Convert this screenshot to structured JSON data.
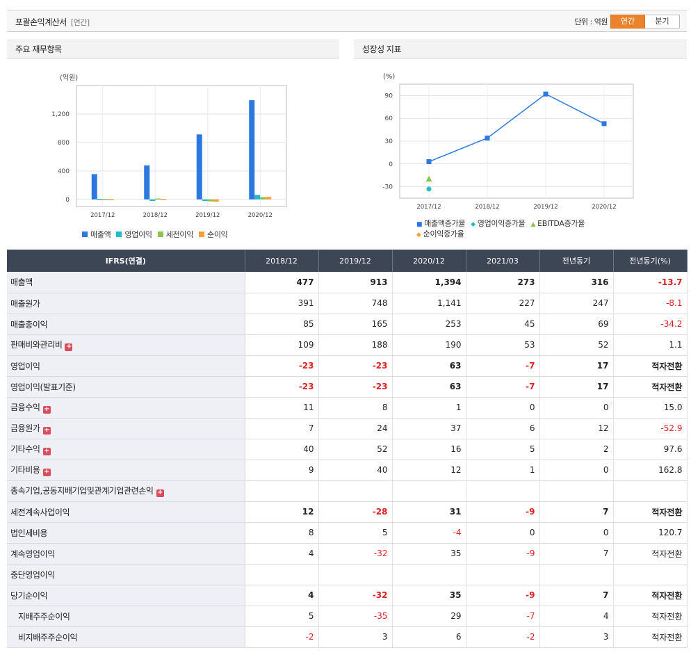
{
  "header": {
    "title": "포괄손익계산서",
    "period_tag": "[연간]",
    "unit_label": "단위 : 억원",
    "toggle": [
      "연간",
      "분기"
    ],
    "toggle_active": 0,
    "accent_color": "#e9842c"
  },
  "panel_left": {
    "title": "주요 재무항목"
  },
  "panel_right": {
    "title": "성장성 지표"
  },
  "chart_data": [
    {
      "type": "bar",
      "unit_label": "(억원)",
      "categories": [
        "2017/12",
        "2018/12",
        "2019/12",
        "2020/12"
      ],
      "ylim": [
        -100,
        1600
      ],
      "yticks": [
        0,
        400,
        800,
        1200
      ],
      "ytick_labels": [
        "0",
        "400",
        "800",
        "1,200"
      ],
      "series": [
        {
          "name": "매출액",
          "color": "#2b79e0",
          "values": [
            355,
            477,
            913,
            1394
          ]
        },
        {
          "name": "영업이익",
          "color": "#22bcc6",
          "values": [
            4,
            -23,
            -23,
            63
          ]
        },
        {
          "name": "세전이익",
          "color": "#8bc34a",
          "values": [
            4,
            12,
            -28,
            31
          ]
        },
        {
          "name": "순이익",
          "color": "#f4a037",
          "values": [
            2,
            4,
            -32,
            35
          ]
        }
      ],
      "grid": true,
      "legend": "bottom"
    },
    {
      "type": "line",
      "unit_label": "(%)",
      "categories": [
        "2017/12",
        "2018/12",
        "2019/12",
        "2020/12"
      ],
      "ylim": [
        -45,
        105
      ],
      "yticks": [
        -30,
        0,
        30,
        60,
        90
      ],
      "ytick_labels": [
        "-30",
        "0",
        "30",
        "60",
        "90"
      ],
      "series": [
        {
          "name": "매출액증가율",
          "color": "#2b79e0",
          "marker": "square",
          "values": [
            3,
            34,
            92,
            53
          ]
        },
        {
          "name": "영업이익증가율",
          "color": "#22bcc6",
          "marker": "diamond",
          "values": [
            -33,
            null,
            null,
            null
          ]
        },
        {
          "name": "EBITDA증가율",
          "color": "#8bc34a",
          "marker": "triangle",
          "values": [
            -20,
            null,
            null,
            null
          ]
        },
        {
          "name": "순이익증가율",
          "color": "#f4a037",
          "marker": "diamond",
          "values": [
            null,
            null,
            null,
            null
          ]
        }
      ],
      "grid": true,
      "legend": "bottom"
    }
  ],
  "table": {
    "columns": [
      "IFRS(연결)",
      "2018/12",
      "2019/12",
      "2020/12",
      "2021/03",
      "전년동기",
      "전년동기(%)"
    ],
    "rows": [
      {
        "label": "매출액",
        "bold": true,
        "expand": false,
        "indent": false,
        "values": [
          "477",
          "913",
          "1,394",
          "273",
          "316",
          "-13.7"
        ]
      },
      {
        "label": "매출원가",
        "bold": false,
        "expand": false,
        "indent": false,
        "values": [
          "391",
          "748",
          "1,141",
          "227",
          "247",
          "-8.1"
        ]
      },
      {
        "label": "매출총이익",
        "bold": false,
        "expand": false,
        "indent": false,
        "values": [
          "85",
          "165",
          "253",
          "45",
          "69",
          "-34.2"
        ]
      },
      {
        "label": "판매비와관리비",
        "bold": false,
        "expand": true,
        "indent": false,
        "values": [
          "109",
          "188",
          "190",
          "53",
          "52",
          "1.1"
        ]
      },
      {
        "label": "영업이익",
        "bold": true,
        "expand": false,
        "indent": false,
        "values": [
          "-23",
          "-23",
          "63",
          "-7",
          "17",
          "적자전환"
        ]
      },
      {
        "label": "영업이익(발표기준)",
        "bold": true,
        "expand": false,
        "indent": false,
        "values": [
          "-23",
          "-23",
          "63",
          "-7",
          "17",
          "적자전환"
        ]
      },
      {
        "label": "금융수익",
        "bold": false,
        "expand": true,
        "indent": false,
        "values": [
          "11",
          "8",
          "1",
          "0",
          "0",
          "15.0"
        ]
      },
      {
        "label": "금융원가",
        "bold": false,
        "expand": true,
        "indent": false,
        "values": [
          "7",
          "24",
          "37",
          "6",
          "12",
          "-52.9"
        ]
      },
      {
        "label": "기타수익",
        "bold": false,
        "expand": true,
        "indent": false,
        "values": [
          "40",
          "52",
          "16",
          "5",
          "2",
          "97.6"
        ]
      },
      {
        "label": "기타비용",
        "bold": false,
        "expand": true,
        "indent": false,
        "values": [
          "9",
          "40",
          "12",
          "1",
          "0",
          "162.8"
        ]
      },
      {
        "label": "종속기업,공동지배기업및관계기업관련손익",
        "bold": false,
        "expand": true,
        "indent": false,
        "values": [
          "",
          "",
          "",
          "",
          "",
          ""
        ]
      },
      {
        "label": "세전계속사업이익",
        "bold": true,
        "expand": false,
        "indent": false,
        "values": [
          "12",
          "-28",
          "31",
          "-9",
          "7",
          "적자전환"
        ]
      },
      {
        "label": "법인세비용",
        "bold": false,
        "expand": false,
        "indent": false,
        "values": [
          "8",
          "5",
          "-4",
          "0",
          "0",
          "120.7"
        ]
      },
      {
        "label": "계속영업이익",
        "bold": false,
        "expand": false,
        "indent": false,
        "values": [
          "4",
          "-32",
          "35",
          "-9",
          "7",
          "적자전환"
        ]
      },
      {
        "label": "중단영업이익",
        "bold": false,
        "expand": false,
        "indent": false,
        "values": [
          "",
          "",
          "",
          "",
          "",
          ""
        ]
      },
      {
        "label": "당기순이익",
        "bold": true,
        "expand": false,
        "indent": false,
        "values": [
          "4",
          "-32",
          "35",
          "-9",
          "7",
          "적자전환"
        ]
      },
      {
        "label": "지배주주순이익",
        "bold": false,
        "expand": false,
        "indent": true,
        "values": [
          "5",
          "-35",
          "29",
          "-7",
          "4",
          "적자전환"
        ]
      },
      {
        "label": "비지배주주순이익",
        "bold": false,
        "expand": false,
        "indent": true,
        "values": [
          "-2",
          "3",
          "6",
          "-2",
          "3",
          "적자전환"
        ]
      }
    ]
  }
}
